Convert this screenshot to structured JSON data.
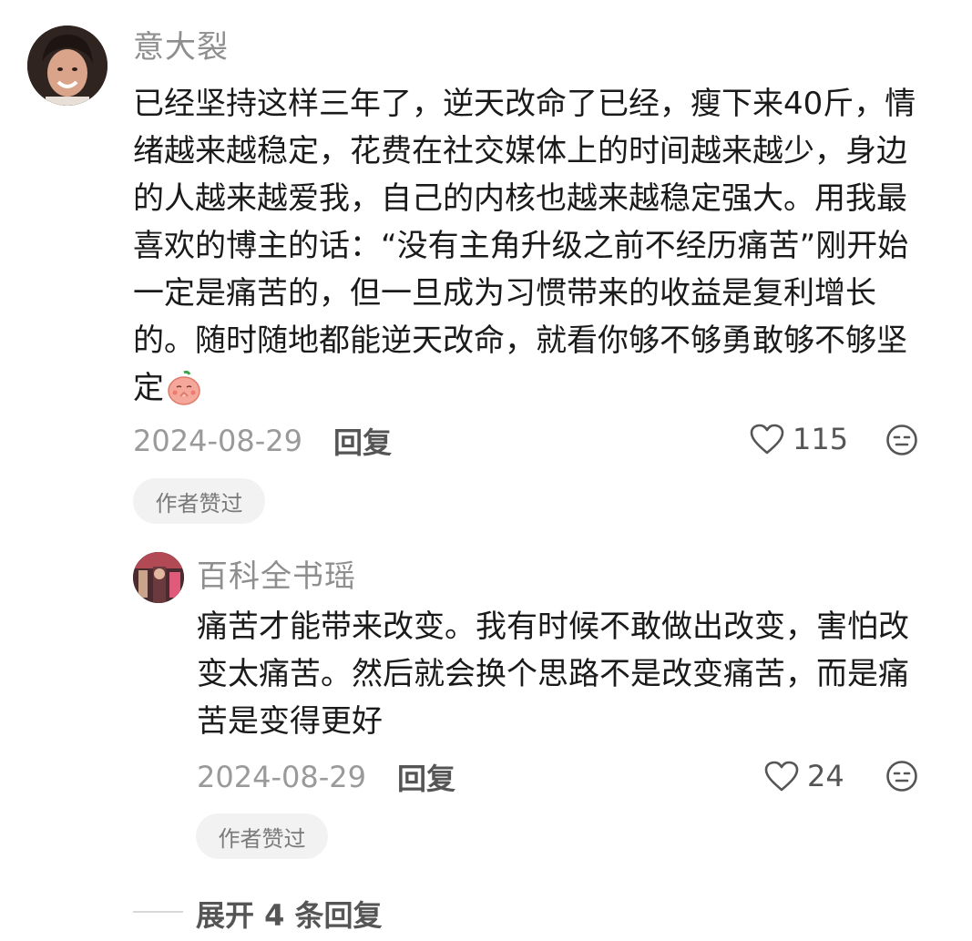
{
  "comment": {
    "username": "意大裂",
    "text": "已经坚持这样三年了，逆天改命了已经，瘦下来40斤，情绪越来越稳定，花费在社交媒体上的时间越来越少，身边的人越来越爱我，自己的内核也越来越稳定强大。用我最喜欢的博主的话：“没有主角升级之前不经历痛苦”刚开始一定是痛苦的，但一旦成为习惯带来的收益是复利增长的。随时随地都能逆天改命，就看你够不够勇敢够不够坚定",
    "emoji": "praying-peach-emoji",
    "date": "2024-08-29",
    "reply_label": "回复",
    "likes": "115",
    "badge": "作者赞过"
  },
  "reply": {
    "username": "百科全书瑶",
    "text": "痛苦才能带来改变。我有时候不敢做出改变，害怕改变太痛苦。然后就会换个思路不是改变痛苦，而是痛苦是变得更好",
    "date": "2024-08-29",
    "reply_label": "回复",
    "likes": "24",
    "badge": "作者赞过"
  },
  "expand": {
    "label": "展开 4 条回复"
  },
  "colors": {
    "text": "#1a1a1a",
    "muted": "#9a9a9a",
    "badge_bg": "#f2f2f2"
  }
}
